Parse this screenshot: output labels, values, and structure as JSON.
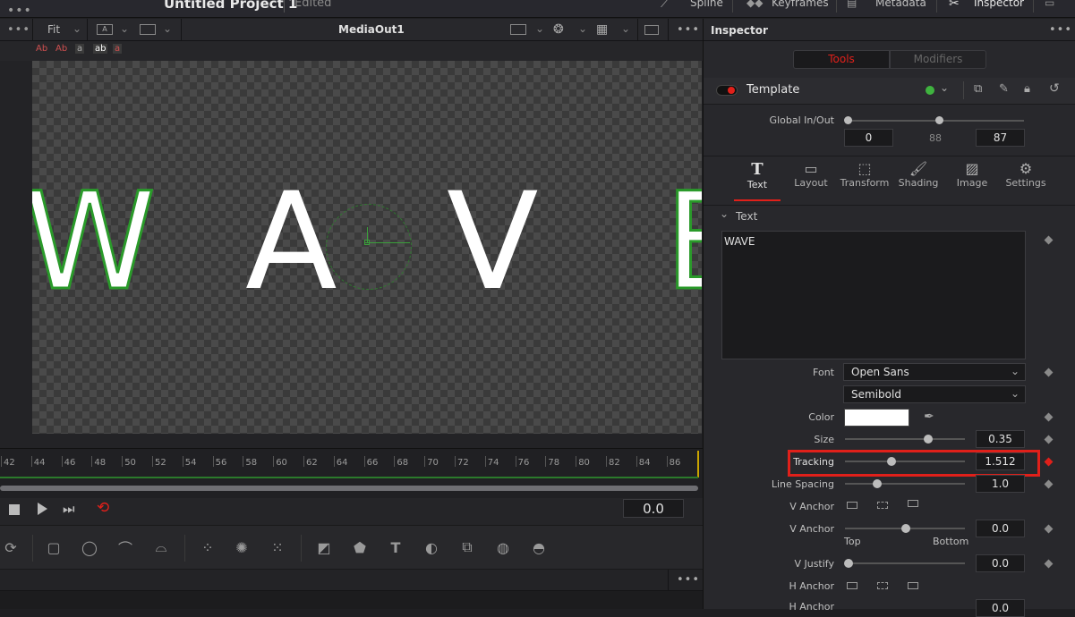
{
  "topbar": {
    "project_title": "Untitled Project 1",
    "edited": "Edited",
    "menu": [
      "Spline",
      "Keyframes",
      "Metadata",
      "Inspector"
    ]
  },
  "viewer": {
    "zoom": "Fit",
    "title": "MediaOut1",
    "overlay_chips": [
      "Ab",
      "Ab",
      "a",
      "ab",
      "a"
    ],
    "text_letters": [
      "W",
      "A",
      "V",
      "E"
    ]
  },
  "ruler": {
    "ticks": [
      "42",
      "44",
      "46",
      "48",
      "50",
      "52",
      "54",
      "56",
      "58",
      "60",
      "62",
      "64",
      "66",
      "68",
      "70",
      "72",
      "74",
      "76",
      "78",
      "80",
      "82",
      "84",
      "86"
    ]
  },
  "transport": {
    "timecode": "0.0"
  },
  "inspector": {
    "title": "Inspector",
    "segment": [
      "Tools",
      "Modifiers"
    ],
    "tool_name": "Template",
    "global_inout_label": "Global In/Out",
    "global_in": "0",
    "global_mid": "88",
    "global_out": "87",
    "tabs": [
      "Text",
      "Layout",
      "Transform",
      "Shading",
      "Image",
      "Settings"
    ],
    "section": "Text",
    "styled_text": "WAVE",
    "font_label": "Font",
    "font_value": "Open Sans",
    "style_value": "Semibold",
    "color_label": "Color",
    "size_label": "Size",
    "size_value": "0.35",
    "tracking_label": "Tracking",
    "tracking_value": "1.512",
    "line_spacing_label": "Line Spacing",
    "line_spacing_value": "1.0",
    "vanchor_label": "V Anchor",
    "vanchor2_label": "V Anchor",
    "vanchor2_value": "0.0",
    "top_label": "Top",
    "bottom_label": "Bottom",
    "vjustify_label": "V Justify",
    "vjustify_value": "0.0",
    "hanchor_label": "H Anchor",
    "hanchor2_label": "H Anchor",
    "hanchor2_value": "0.0"
  },
  "colors": {
    "accent_red": "#e0201a",
    "active_green": "#3fb33f",
    "text_outline": "#22a022"
  }
}
